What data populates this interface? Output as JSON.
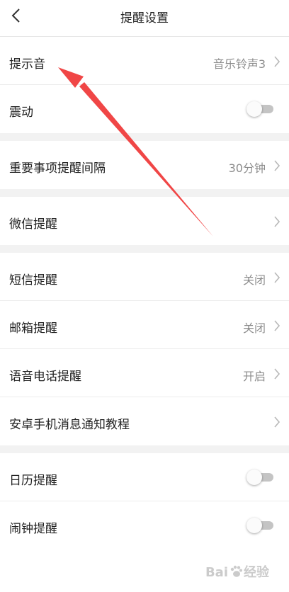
{
  "header": {
    "title": "提醒设置"
  },
  "colors": {
    "annotation_arrow": "#f04646",
    "divider": "#ececec",
    "section_gap": "#f2f2f2",
    "value_text": "#8c8c8c",
    "toggle_off_track": "#c4c4c4"
  },
  "items": [
    {
      "label": "提示音",
      "value": "音乐铃声3",
      "control": "chevron"
    },
    {
      "label": "震动",
      "control": "toggle",
      "on": false
    },
    {
      "label": "重要事项提醒间隔",
      "value": "30分钟",
      "control": "chevron"
    },
    {
      "label": "微信提醒",
      "value": "",
      "control": "chevron"
    },
    {
      "label": "短信提醒",
      "value": "关闭",
      "control": "chevron"
    },
    {
      "label": "邮箱提醒",
      "value": "关闭",
      "control": "chevron"
    },
    {
      "label": "语音电话提醒",
      "value": "开启",
      "control": "chevron"
    },
    {
      "label": "安卓手机消息通知教程",
      "value": "",
      "control": "chevron"
    },
    {
      "label": "日历提醒",
      "control": "toggle",
      "on": false
    },
    {
      "label": "闹钟提醒",
      "control": "toggle",
      "on": false
    }
  ],
  "watermark": {
    "text_left": "Bai",
    "text_right": "经验"
  }
}
